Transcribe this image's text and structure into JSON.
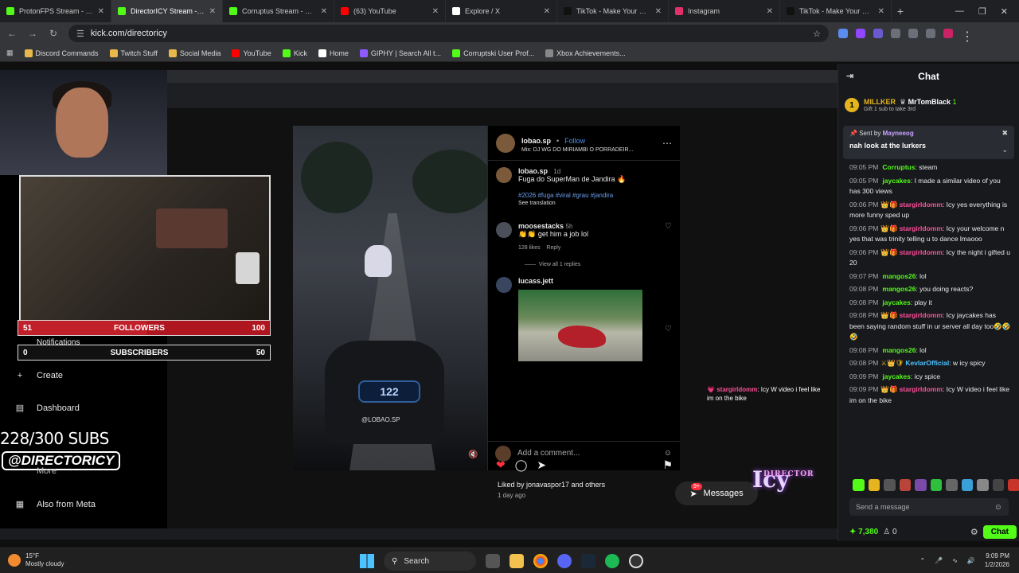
{
  "tabs": [
    {
      "label": "ProtonFPS Stream - Watch",
      "color": "#53fc18",
      "active": false
    },
    {
      "label": "DirectorICY Stream - W",
      "color": "#53fc18",
      "active": true
    },
    {
      "label": "Corruptus Stream - Kick D",
      "color": "#53fc18",
      "active": false
    },
    {
      "label": "(63) YouTube",
      "color": "#ff0000",
      "active": false
    },
    {
      "label": "Explore / X",
      "color": "#ffffff",
      "active": false
    },
    {
      "label": "TikTok - Make Your Day",
      "color": "#111111",
      "active": false
    },
    {
      "label": "Instagram",
      "color": "#e1306c",
      "active": false
    },
    {
      "label": "TikTok - Make Your Day",
      "color": "#111111",
      "active": false
    }
  ],
  "address": {
    "url": "kick.com/directoricy"
  },
  "bookmarks": [
    {
      "label": "Discord Commands",
      "color": "#e8b84a"
    },
    {
      "label": "Twitch Stuff",
      "color": "#e8b84a"
    },
    {
      "label": "Social Media",
      "color": "#e8b84a"
    },
    {
      "label": "YouTube",
      "color": "#ff0000"
    },
    {
      "label": "Kick",
      "color": "#53fc18"
    },
    {
      "label": "Home",
      "color": "#ffffff"
    },
    {
      "label": "GIPHY | Search All t...",
      "color": "#8f5bff"
    },
    {
      "label": "Corruptski User Prof...",
      "color": "#53fc18"
    },
    {
      "label": "Xbox Achievements...",
      "color": "#888888"
    }
  ],
  "instagram": {
    "author": "lobao.sp",
    "follow": "Follow",
    "music": "Mix: DJ WG DO MIRIAMBI O PORRADEIR...",
    "caption_user": "lobao.sp",
    "caption_time": "1d",
    "caption": "Fuga do SuperMan de Jandira 🔥",
    "hashtags": "#2026 #fuga #viral #grau #jandira",
    "see_translation": "See translation",
    "comment_user": "moosestacks",
    "comment_time": "5h",
    "comment": "👏👏 get him a job lol",
    "comment_likes": "128 likes",
    "reply": "Reply",
    "view_replies": "View all 1 replies",
    "gif_user": "lucass.jett",
    "speed": "122",
    "watermark": "@LOBAO.SP",
    "liked_by": "Liked by jonavaspor17 and others",
    "posted": "1 day ago",
    "add_comment": "Add a comment..."
  },
  "messages_button": {
    "label": "Messages",
    "badge": "9+"
  },
  "overlay_chat": {
    "user": "stargirldomm",
    "text": ": Icy W video i feel like im on the bike"
  },
  "overlay": {
    "followers_current": "51",
    "followers_label": "FOLLOWERS",
    "followers_goal": "100",
    "followers_fraction": 0.51,
    "subs_current": "0",
    "subs_label": "SUBSCRIBERS",
    "subs_goal": "50",
    "subs_text": "228/300 SUBS",
    "handle": "@DIRECTORICY",
    "logo_text": "Icy",
    "logo_small": "DIRECTOR"
  },
  "side_nav": {
    "notifications": "Notifications",
    "create": "Create",
    "dashboard": "Dashboard",
    "more": "More",
    "meta": "Also from Meta"
  },
  "chat": {
    "title": "Chat",
    "pinned_user1": "MILLKER",
    "pinned_user2": "MrTomBlack",
    "pinned_count": "1",
    "pinned_sub": "Gift 1 sub to take 3rd",
    "sent_by_label": "Sent by",
    "sent_by_user": "Mayneeog",
    "sent_msg": "nah look at the lurkers",
    "messages": [
      {
        "time": "09:05 PM",
        "user": "Corruptus",
        "color": "#53fc18",
        "badges": "",
        "text": ": steam"
      },
      {
        "time": "09:05 PM",
        "user": "jaycakes",
        "color": "#53fc18",
        "badges": "",
        "text": ": I made a similar video of you has 300 views"
      },
      {
        "time": "09:06 PM",
        "user": "stargirldomm",
        "color": "#ff4f9a",
        "badges": "👑🎁",
        "text": ": Icy yes everything is more funny sped up"
      },
      {
        "time": "09:06 PM",
        "user": "stargirldomm",
        "color": "#ff4f9a",
        "badges": "👑🎁",
        "text": ": Icy your welcome n yes that was trinity telling u to dance lmaooo"
      },
      {
        "time": "09:06 PM",
        "user": "stargirldomm",
        "color": "#ff4f9a",
        "badges": "👑🎁",
        "text": ": Icy the night i gifted u 20"
      },
      {
        "time": "09:07 PM",
        "user": "mangos26",
        "color": "#53fc18",
        "badges": "",
        "text": ": lol"
      },
      {
        "time": "09:08 PM",
        "user": "mangos26",
        "color": "#53fc18",
        "badges": "",
        "text": ": you doing reacts?"
      },
      {
        "time": "09:08 PM",
        "user": "jaycakes",
        "color": "#53fc18",
        "badges": "",
        "text": ": play it"
      },
      {
        "time": "09:08 PM",
        "user": "stargirldomm",
        "color": "#ff4f9a",
        "badges": "👑🎁",
        "text": ": Icy jaycakes has been saying random stuff in ur server all day too🤣🤣🤣"
      },
      {
        "time": "09:08 PM",
        "user": "mangos26",
        "color": "#53fc18",
        "badges": "",
        "text": ": lol"
      },
      {
        "time": "09:08 PM",
        "user": "KevlarOfficial",
        "color": "#4cc2ff",
        "badges": "⚔👑🛡",
        "text": ": w icy spicy"
      },
      {
        "time": "09:09 PM",
        "user": "jaycakes",
        "color": "#53fc18",
        "badges": "",
        "text": ": icy spice"
      },
      {
        "time": "09:09 PM",
        "user": "stargirldomm",
        "color": "#ff4f9a",
        "badges": "👑🎁",
        "text": ": Icy W video i feel like im on the bike"
      }
    ],
    "send_placeholder": "Send a message",
    "points": "7,380",
    "viewers": "0",
    "send_button": "Chat"
  },
  "taskbar": {
    "temp": "15°F",
    "weather": "Mostly cloudy",
    "search": "Search",
    "time": "9:09 PM",
    "date": "1/2/2026"
  }
}
